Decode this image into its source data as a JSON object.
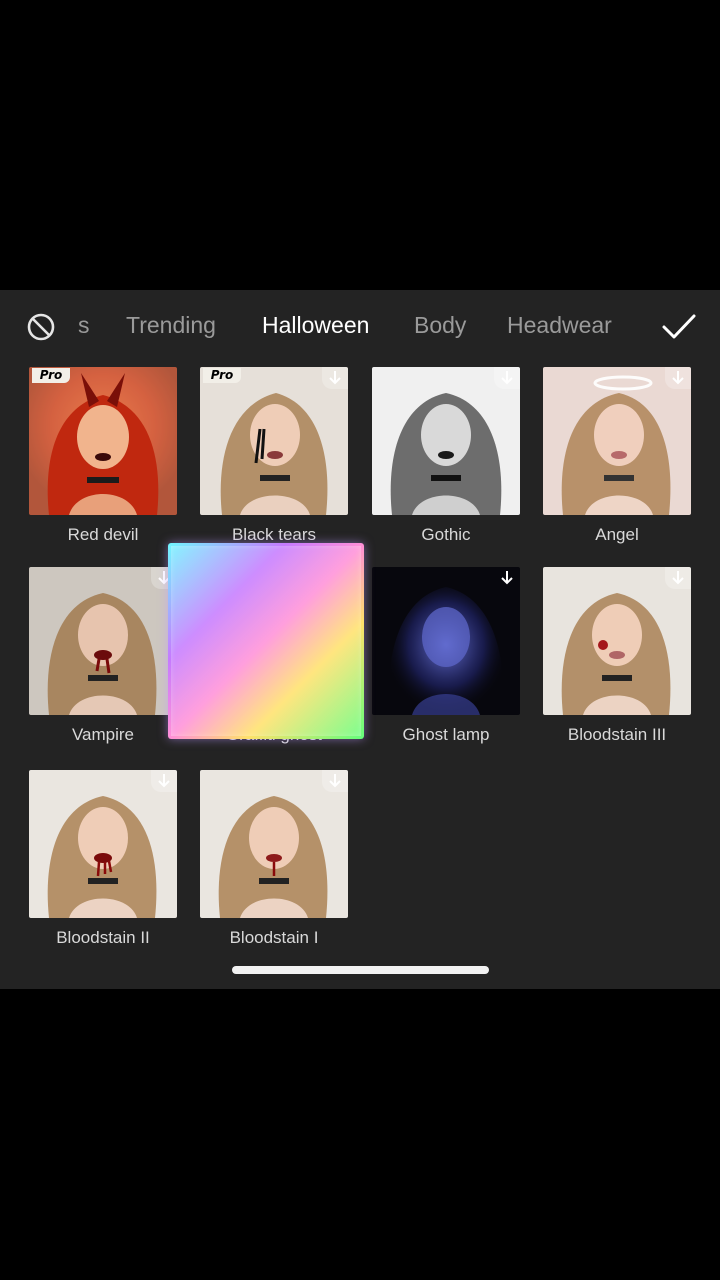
{
  "tabs": {
    "partial_label": "s",
    "items": [
      {
        "label": "Trending",
        "active": false
      },
      {
        "label": "Halloween",
        "active": true
      },
      {
        "label": "Body",
        "active": false
      },
      {
        "label": "Headwear",
        "active": false
      }
    ],
    "none_icon": "no-effect-icon",
    "confirm_icon": "checkmark-icon"
  },
  "effects": [
    {
      "label": "Red devil",
      "pro": true,
      "pro_text": "Pro",
      "downloaded": false
    },
    {
      "label": "Black tears",
      "pro": true,
      "pro_text": "Pro",
      "downloaded": false
    },
    {
      "label": "Gothic",
      "pro": false,
      "downloaded": false
    },
    {
      "label": "Angel",
      "pro": false,
      "downloaded": false
    },
    {
      "label": "Vampire",
      "pro": false,
      "downloaded": false
    },
    {
      "label": "Graffiti ghost",
      "pro": false,
      "downloaded": false,
      "selected": true
    },
    {
      "label": "Ghost lamp",
      "pro": false,
      "downloaded": false
    },
    {
      "label": "Bloodstain III",
      "pro": false,
      "downloaded": false
    },
    {
      "label": "Bloodstain II",
      "pro": false,
      "downloaded": false
    },
    {
      "label": "Bloodstain I",
      "pro": false,
      "downloaded": false
    }
  ],
  "colors": {
    "panel_background": "#232323",
    "active_tab": "#ffffff",
    "inactive_tab": "#9a9a9a",
    "label_text": "#d9d9d9"
  }
}
